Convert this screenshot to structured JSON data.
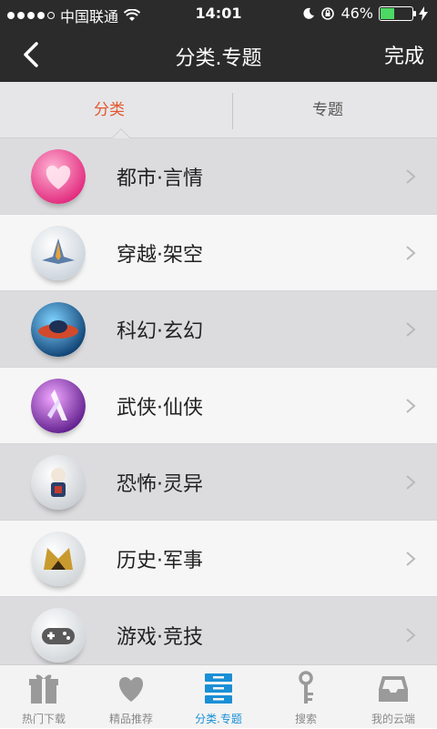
{
  "status_bar": {
    "carrier": "中国联通",
    "time": "14:01",
    "battery_percent": "46%",
    "battery_level": 0.46,
    "battery_color": "#4cd964"
  },
  "nav": {
    "title": "分类.专题",
    "done_label": "完成",
    "back_icon": "chevron-left-icon"
  },
  "tabs": [
    {
      "label": "分类",
      "active": true
    },
    {
      "label": "专题",
      "active": false
    }
  ],
  "accent_color": "#e4572e",
  "categories": [
    {
      "label": "都市·言情",
      "icon": "heart-orb-icon"
    },
    {
      "label": "穿越·架空",
      "icon": "spaceship-orb-icon"
    },
    {
      "label": "科幻·玄幻",
      "icon": "ufo-orb-icon"
    },
    {
      "label": "武侠·仙侠",
      "icon": "warrior-orb-icon"
    },
    {
      "label": "恐怖·灵异",
      "icon": "ghost-orb-icon"
    },
    {
      "label": "历史·军事",
      "icon": "helmet-orb-icon"
    },
    {
      "label": "游戏·竞技",
      "icon": "gamepad-orb-icon"
    }
  ],
  "tab_bar": {
    "items": [
      {
        "label": "热门下载",
        "icon": "gift-icon",
        "active": false
      },
      {
        "label": "精品推荐",
        "icon": "heart-icon",
        "active": false
      },
      {
        "label": "分类.专题",
        "icon": "list-icon",
        "active": true
      },
      {
        "label": "搜索",
        "icon": "key-icon",
        "active": false
      },
      {
        "label": "我的云端",
        "icon": "inbox-icon",
        "active": false
      }
    ],
    "active_color": "#1a8fd6"
  }
}
